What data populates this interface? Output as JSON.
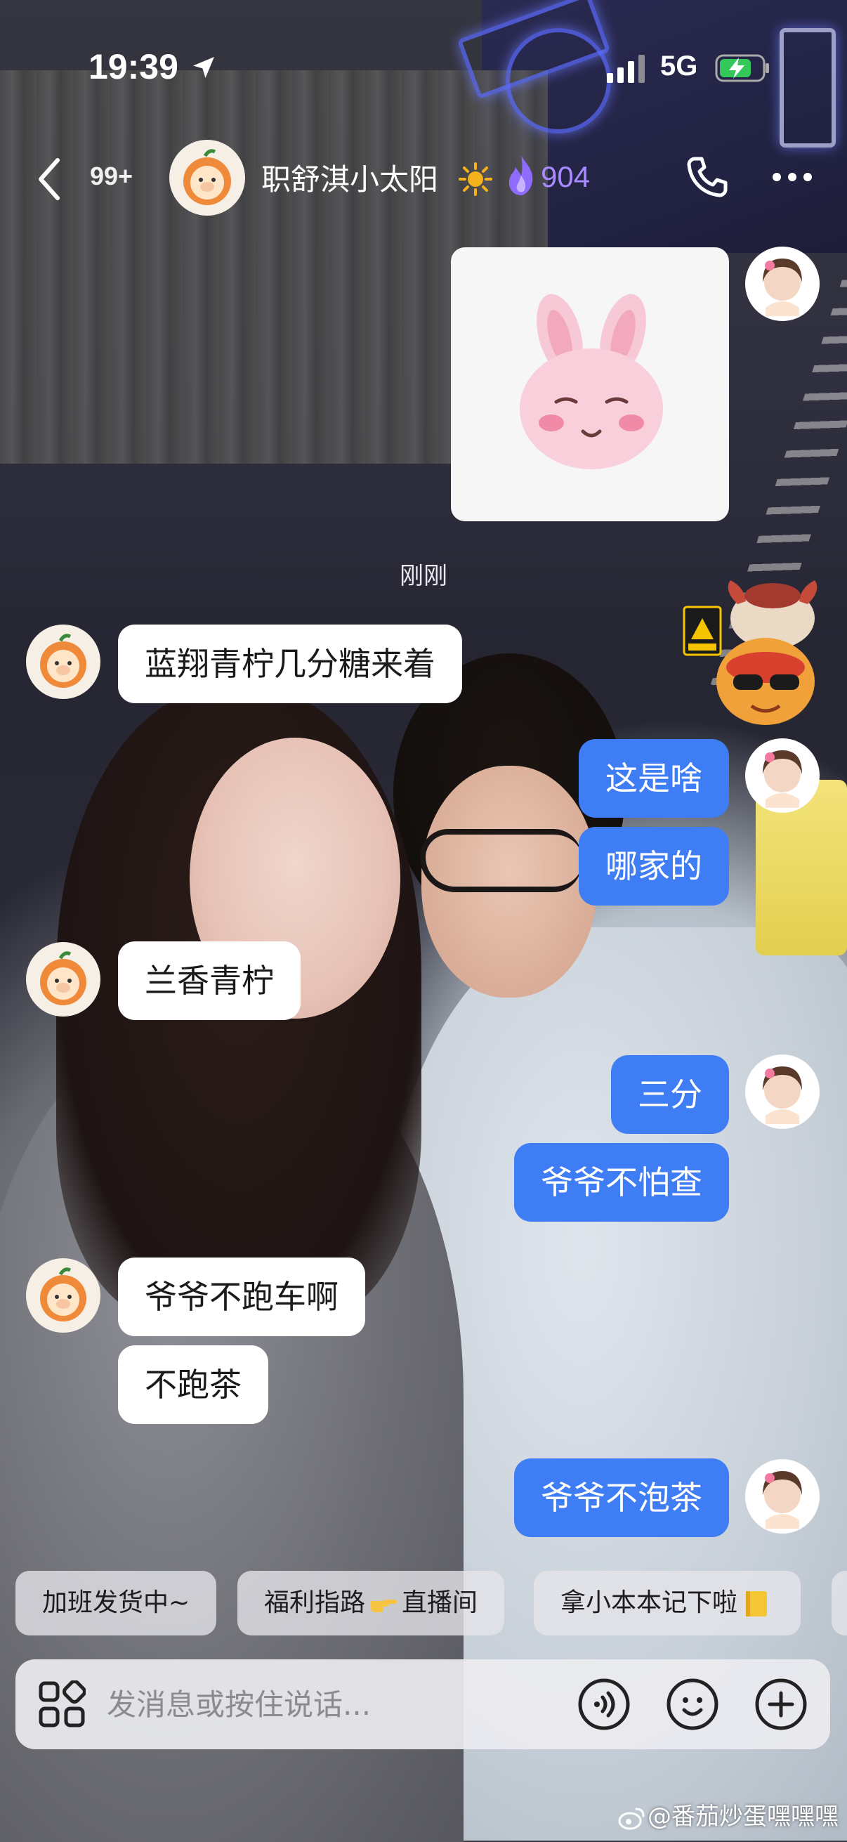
{
  "status_bar": {
    "time": "19:39",
    "network": "5G",
    "icons": [
      "location-arrow-icon",
      "signal-bars-icon",
      "battery-charging-icon"
    ]
  },
  "header": {
    "unread_count": "99+",
    "contact_name": "职舒淇小太阳",
    "name_emoji": "sun-icon",
    "spark_score": "904",
    "spark_color": "#a98bff",
    "icons": [
      "back-chevron-icon",
      "phone-icon",
      "more-dots-icon"
    ]
  },
  "messages": {
    "sticker": {
      "from": "me",
      "description_icon": "pink-bunny-sticker"
    },
    "timestamp": "刚刚",
    "m1": "蓝翔青柠几分糖来着",
    "m2": "这是啥",
    "m3": "哪家的",
    "m4": "兰香青柠",
    "m5": "三分",
    "m6": "爷爷不怕查",
    "m7": "爷爷不跑车啊",
    "m8": "不跑茶",
    "m9": "爷爷不泡茶"
  },
  "quick_replies": {
    "c1": "加班发货中~",
    "c2_a": "福利指路",
    "c2_emoji": "pointing-hand-icon",
    "c2_b": "直播间",
    "c3": "拿小本本记下啦",
    "c3_emoji": "notebook-icon"
  },
  "input": {
    "placeholder": "发消息或按住说话...",
    "icons": [
      "apps-grid-icon",
      "voice-icon",
      "emoji-face-icon",
      "add-icon"
    ]
  },
  "watermark": "@番茄炒蛋嘿嘿嘿",
  "colors": {
    "outgoing_bubble": "#3f7df5",
    "incoming_bubble": "#ffffff"
  }
}
